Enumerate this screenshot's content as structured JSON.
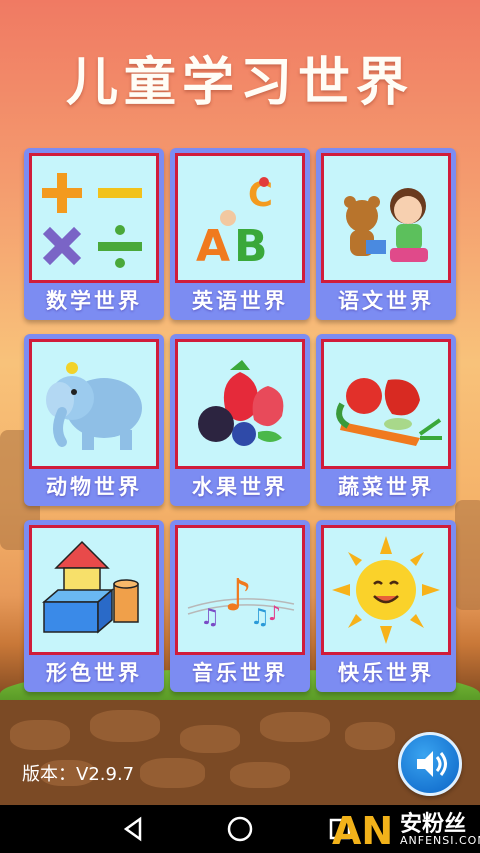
{
  "app": {
    "title": "儿童学习世界"
  },
  "cards": [
    {
      "label": "数学世界",
      "icon": "math-symbols-icon"
    },
    {
      "label": "英语世界",
      "icon": "abc-letters-icon"
    },
    {
      "label": "语文世界",
      "icon": "bear-girl-icon"
    },
    {
      "label": "动物世界",
      "icon": "elephant-icon"
    },
    {
      "label": "水果世界",
      "icon": "fruits-icon"
    },
    {
      "label": "蔬菜世界",
      "icon": "vegetables-icon"
    },
    {
      "label": "形色世界",
      "icon": "shape-blocks-icon"
    },
    {
      "label": "音乐世界",
      "icon": "music-notes-icon"
    },
    {
      "label": "快乐世界",
      "icon": "sun-icon"
    }
  ],
  "footer": {
    "version": "版本：V2.9.7"
  },
  "watermark": {
    "brand": "AN",
    "text": "安粉丝",
    "sub": "ANFENSI.COM"
  },
  "colors": {
    "card": "#7c8cf2",
    "frame": "#d01c3a",
    "pic_bg": "#c6f5fb"
  }
}
